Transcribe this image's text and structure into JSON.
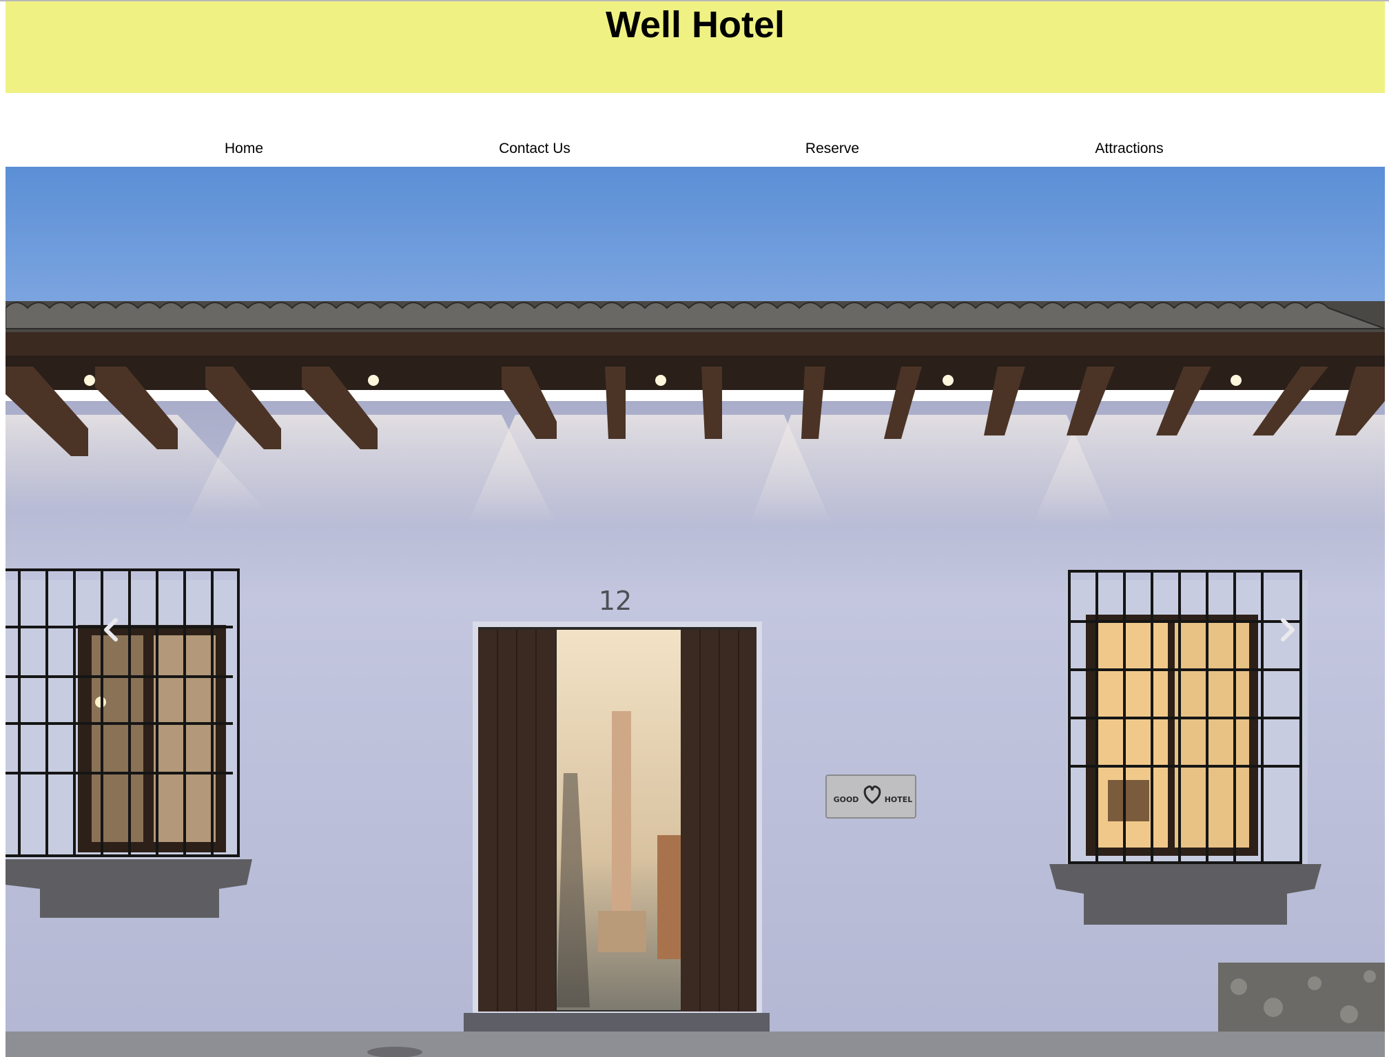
{
  "site": {
    "title": "Well Hotel"
  },
  "nav": {
    "items": [
      {
        "label": "Home"
      },
      {
        "label": "Contact Us"
      },
      {
        "label": "Reserve"
      },
      {
        "label": "Attractions"
      }
    ]
  },
  "hero": {
    "house_number": "12",
    "sign_left": "GOOD",
    "sign_right": "HOTEL"
  },
  "carousel": {
    "prev_icon": "chevron-left-icon",
    "next_icon": "chevron-right-icon"
  },
  "colors": {
    "header_bg": "#eff282",
    "sky_top": "#4d86cf",
    "wall": "#b9bdd9"
  }
}
